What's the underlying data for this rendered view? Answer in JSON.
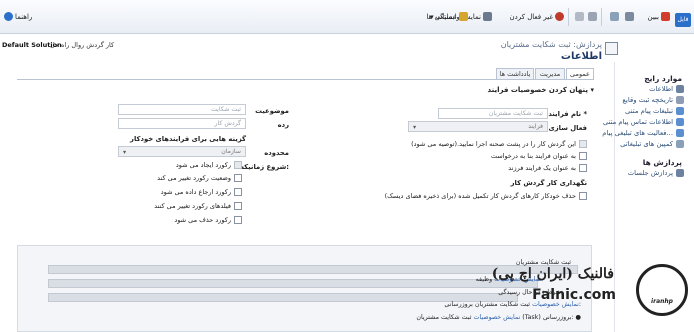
{
  "ribbon": {
    "file_tab": "فایل",
    "save_close": "ببین",
    "new": "",
    "deactivate": "غیر فعال کردن",
    "dependencies": "نمایش وابستگی ها",
    "actions": "عملیات",
    "help": "راهنما"
  },
  "header": {
    "breadcrumb": "پردازش: ثبت شکایت مشتریان",
    "title": "اطلاعات",
    "process_label": "کار گردش روال راه حل",
    "process_value": "Default Solution"
  },
  "sidebar": {
    "section1": "موارد رایج",
    "items1": [
      "اطلاعات",
      "تاریخچه ثبت وقایع",
      "تبلیغات پیام متنی",
      "اطلاعات تماس پیام متنی",
      "فعالیت های تبلیغی پیام...",
      "کمپین های تبلیغاتی"
    ],
    "section2": "پردازش ها",
    "items2": [
      "پردازش جلسات"
    ]
  },
  "tabs": [
    "عمومی",
    "مدیریت",
    "یادداشت ها"
  ],
  "form": {
    "toggle": "پنهان کردن خصوصیات فرایند",
    "process_name_label": "نام فرایند *",
    "process_name_value": "ثبت شکایت مشتریان",
    "activate_as_label": "فعال سازی به عنوان",
    "activate_as_value": "فرایند",
    "subject_label": "موضوعیت",
    "subject_value": "ثبت شکایت",
    "category_label": "رده",
    "category_value": "گردش کار",
    "auto_options_label": "گزینه هایی برای فرایندهای خودکار",
    "scope_label": "محدوده",
    "scope_value": "سازمان",
    "start_when_label": "شروع زمانیکه:",
    "opt_run_on_demand": "این گردش کار را در پشت صحنه اجرا نمایید.(توصیه می شود)",
    "opt_on_demand": "به عنوان فرایند بنا به درخواست",
    "opt_child": "به عنوان یک فرایند فرزند",
    "retention_label": "نگهداری کار گردش کار",
    "opt_delete_jobs": "حذف خودکار کارهای گردش کار تکمیل شده (برای ذخیره فضای دیسک)",
    "start_opts": [
      "رکورد ایجاد می شود",
      "وضعیت رکورد تغییر می کند",
      "رکورد ارجاع داده می شود",
      "فیلدهای رکورد تغییر می کنند",
      "رکورد حذف می شود"
    ]
  },
  "panel": {
    "step_title": "ثبت شکایت مشتریان",
    "step_row2_label": "وظیفه",
    "step_row2_link": "نمایش خصوصیات",
    "step_row3": "شرط : در حال رسیدگی",
    "step_row4_label": "بروزرسانی:",
    "step_row4_text": "ثبت شکایت مشتریان",
    "step_row4_link": "نمایش خصوصیات",
    "step_row5_label": "بروزرسانی:",
    "step_row5_text": "ثبت شکایت مشتریان (Task)",
    "step_row5_link": "نمایش خصوصیات"
  },
  "watermark": {
    "line1": "فالنیک (ایران اچ پی)",
    "line2": "Falnic.com",
    "logo": "iranhp"
  }
}
